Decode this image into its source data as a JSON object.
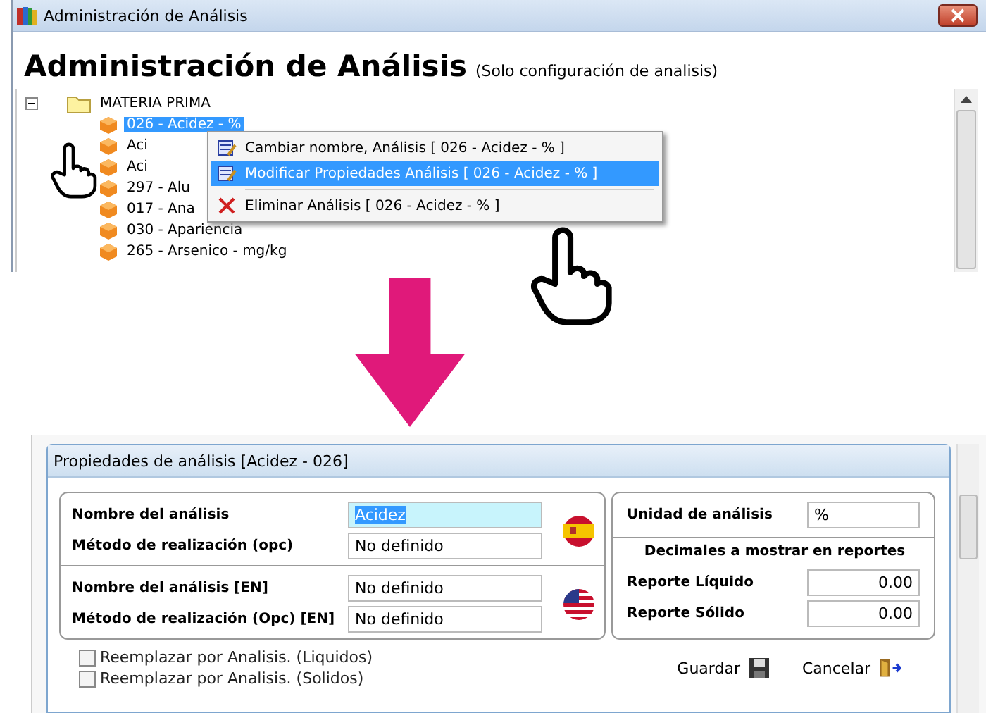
{
  "main_window": {
    "title": "Administración de Análisis",
    "heading": "Administración de Análisis",
    "subtitle": "(Solo configuración de analisis)",
    "tree": {
      "label": "MATERIA PRIMA",
      "expanded": true,
      "children": [
        {
          "label": "026 - Acidez - %",
          "selected": true
        },
        {
          "label": "Aci",
          "selected": false
        },
        {
          "label": "Aci",
          "selected": false
        },
        {
          "label": "297 - Alu",
          "selected": false
        },
        {
          "label": "017 - Ana",
          "selected": false
        },
        {
          "label": "030 - Apariencia",
          "selected": false
        },
        {
          "label": "265 - Arsenico - mg/kg",
          "selected": false
        }
      ]
    },
    "context_menu": [
      {
        "label": "Cambiar nombre, Análisis [ 026 - Acidez - % ]",
        "kind": "edit",
        "selected": false
      },
      {
        "label": "Modificar Propiedades Análisis [ 026 - Acidez - % ]",
        "kind": "edit",
        "selected": true
      },
      {
        "label": "Eliminar Análisis [ 026 - Acidez - % ]",
        "kind": "delete",
        "selected": false
      }
    ]
  },
  "dialog": {
    "title": "Propiedades de análisis [Acidez - 026]",
    "language_panels": [
      {
        "kind": "spanish",
        "fields": [
          {
            "label": "Nombre del análisis",
            "value": "Acidez",
            "selected": true
          },
          {
            "label": "Método de realización (opc)",
            "value": "No definido",
            "selected": false
          }
        ]
      },
      {
        "kind": "english",
        "fields": [
          {
            "label": "Nombre del análisis [EN]",
            "value": "No definido",
            "selected": false
          },
          {
            "label": "Método de realización (Opc) [EN]",
            "value": "No definido",
            "selected": false
          }
        ]
      }
    ],
    "unit": {
      "label": "Unidad de análisis",
      "value": "%"
    },
    "decimals": {
      "title": "Decimales a mostrar en reportes",
      "fields": [
        {
          "label": "Reporte Líquido",
          "value": "0.00"
        },
        {
          "label": "Reporte Sólido",
          "value": "0.00"
        }
      ]
    },
    "checkboxes": [
      {
        "label": "Reemplazar por Analisis. (Liquidos)",
        "checked": false
      },
      {
        "label": "Reemplazar por Analisis. (Solidos)",
        "checked": false
      }
    ],
    "buttons": [
      {
        "label": "Guardar",
        "kind": "save"
      },
      {
        "label": "Cancelar",
        "kind": "exit"
      }
    ]
  }
}
